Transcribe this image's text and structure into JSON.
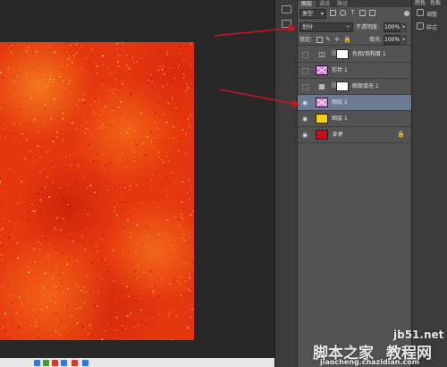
{
  "panel": {
    "tabs": [
      "图层",
      "通道",
      "路径"
    ],
    "filter_kind": "类型",
    "blend_mode": "划分",
    "opacity_label": "不透明度:",
    "opacity_value": "100%",
    "lock_label": "锁定:",
    "fill_label": "填充:",
    "fill_value": "100%"
  },
  "layers": [
    {
      "name": "色相/饱和度 1",
      "visible": false,
      "type": "adjustment",
      "selected": false
    },
    {
      "name": "形状 1",
      "visible": false,
      "type": "shape",
      "selected": false
    },
    {
      "name": "图案填充 1",
      "visible": false,
      "type": "pattern",
      "selected": false
    },
    {
      "name": "图层 2",
      "visible": true,
      "type": "layer",
      "selected": true,
      "thumb_color": "#d98ad6"
    },
    {
      "name": "图层 1",
      "visible": true,
      "type": "layer",
      "selected": false,
      "thumb_color": "#f3d11a"
    },
    {
      "name": "背景",
      "visible": true,
      "type": "background",
      "selected": false,
      "thumb_color": "#c0141c",
      "locked": true
    }
  ],
  "dock": {
    "tabs": [
      "颜色",
      "色板"
    ],
    "sections": [
      "调整",
      "样式"
    ]
  },
  "watermark": {
    "site": "jb51.net",
    "brand_left": "脚本之家",
    "brand_right": "教程网",
    "domain": "jiaocheng.chazidian.com"
  },
  "colors": {
    "canvas_fill": "#e5370f",
    "selected_row": "#6c7a92",
    "annotation_arrow": "#c8161e"
  }
}
